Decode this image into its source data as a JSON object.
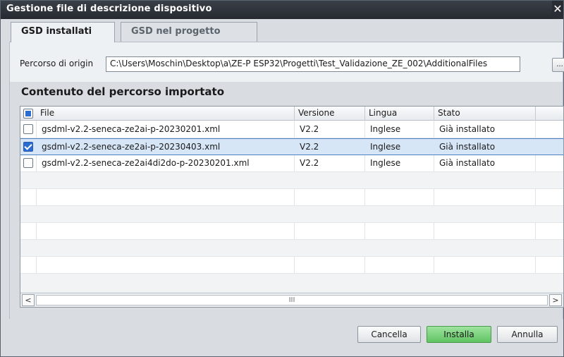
{
  "window": {
    "title": "Gestione file di descrizione dispositivo",
    "close_glyph": "✕"
  },
  "tabs": [
    {
      "label": "GSD installati"
    },
    {
      "label": "GSD nel progetto"
    }
  ],
  "path": {
    "label": "Percorso di origin",
    "value": "C:\\Users\\Moschin\\Desktop\\a\\ZE-P ESP32\\Progetti\\Test_Validazione_ZE_002\\AdditionalFiles",
    "browse_label": "..."
  },
  "section": {
    "title": "Contenuto del percorso importato"
  },
  "table": {
    "headers": {
      "file": "File",
      "version": "Versione",
      "language": "Lingua",
      "status": "Stato"
    },
    "rows": [
      {
        "checked": false,
        "file": "gsdml-v2.2-seneca-ze2ai-p-20230201.xml",
        "version": "V2.2",
        "language": "Inglese",
        "status": "Già installato"
      },
      {
        "checked": true,
        "file": "gsdml-v2.2-seneca-ze2ai-p-20230403.xml",
        "version": "V2.2",
        "language": "Inglese",
        "status": "Già installato"
      },
      {
        "checked": false,
        "file": "gsdml-v2.2-seneca-ze2ai4di2do-p-20230201.xml",
        "version": "V2.2",
        "language": "Inglese",
        "status": "Già installato"
      }
    ]
  },
  "scrollbar": {
    "left_arrow": "<",
    "right_arrow": ">",
    "thumb_glyph": "III"
  },
  "buttons": {
    "cancel": "Cancella",
    "install": "Installa",
    "abort": "Annulla"
  },
  "colors": {
    "accent": "#2b6cd0",
    "primary_button": "#5fc462",
    "selection": "#d6e6f7"
  }
}
